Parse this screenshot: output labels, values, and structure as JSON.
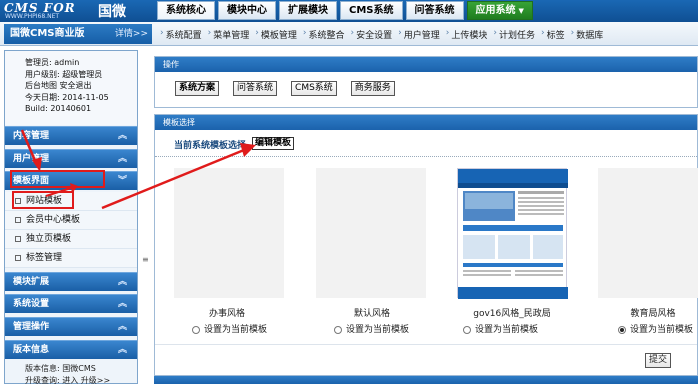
{
  "logo": {
    "main": "CMS FOR",
    "domain": "WWW.PHPI68.NET",
    "cn": "国微"
  },
  "nav_tabs": [
    {
      "label": "系统核心"
    },
    {
      "label": "模块中心"
    },
    {
      "label": "扩展模块"
    },
    {
      "label": "CMS系统"
    },
    {
      "label": "问答系统"
    },
    {
      "label": "应用系统",
      "caret": "▼"
    }
  ],
  "product": {
    "title": "国微CMS商业版",
    "detail": "详情>>"
  },
  "sub_menu": [
    "系统配置",
    "菜单管理",
    "模板管理",
    "系统整合",
    "安全设置",
    "用户管理",
    "上传模块",
    "计划任务",
    "标签",
    "数据库"
  ],
  "sub_menu_sep": "›",
  "user_info": {
    "admin": "管理员: admin",
    "level": "用户级别: 超级管理员",
    "actions": "后台地图  安全退出",
    "date": "今天日期: 2014-11-05",
    "build": "Build: 20140601"
  },
  "sidebar": {
    "arrow_up": "︽",
    "arrow_down": "︾",
    "sections_top": [
      "内容管理",
      "用户管理",
      "模板界面"
    ],
    "template_items": [
      "网站模板",
      "会员中心模板",
      "独立页模板",
      "标签管理"
    ],
    "sections_bottom": [
      "模块扩展",
      "系统设置",
      "管理操作",
      "版本信息"
    ],
    "version_lines": [
      "版本信息: 国微CMS",
      "升级查询: 进入 升级>>"
    ],
    "scroll_grip": "≡"
  },
  "operations": {
    "header": "操作",
    "buttons": [
      "系统方案",
      "问答系统",
      "CMS系统",
      "商务服务"
    ]
  },
  "template_select": {
    "header": "模板选择",
    "title": "当前系统模板选择",
    "edit_button": "编辑模板",
    "templates": [
      {
        "name": "办事风格",
        "radio_label": "设置为当前模板",
        "checked": false
      },
      {
        "name": "默认风格",
        "radio_label": "设置为当前模板",
        "checked": false
      },
      {
        "name": "gov16风格_民政局",
        "radio_label": "设置为当前模板",
        "checked": false
      },
      {
        "name": "教育局风格",
        "radio_label": "设置为当前模板",
        "checked": true
      }
    ],
    "submit": "提交"
  },
  "colors": {
    "header_blue": "#1a68b4",
    "green_tab": "#2c8f2c",
    "annotation_red": "#e01b1b"
  }
}
